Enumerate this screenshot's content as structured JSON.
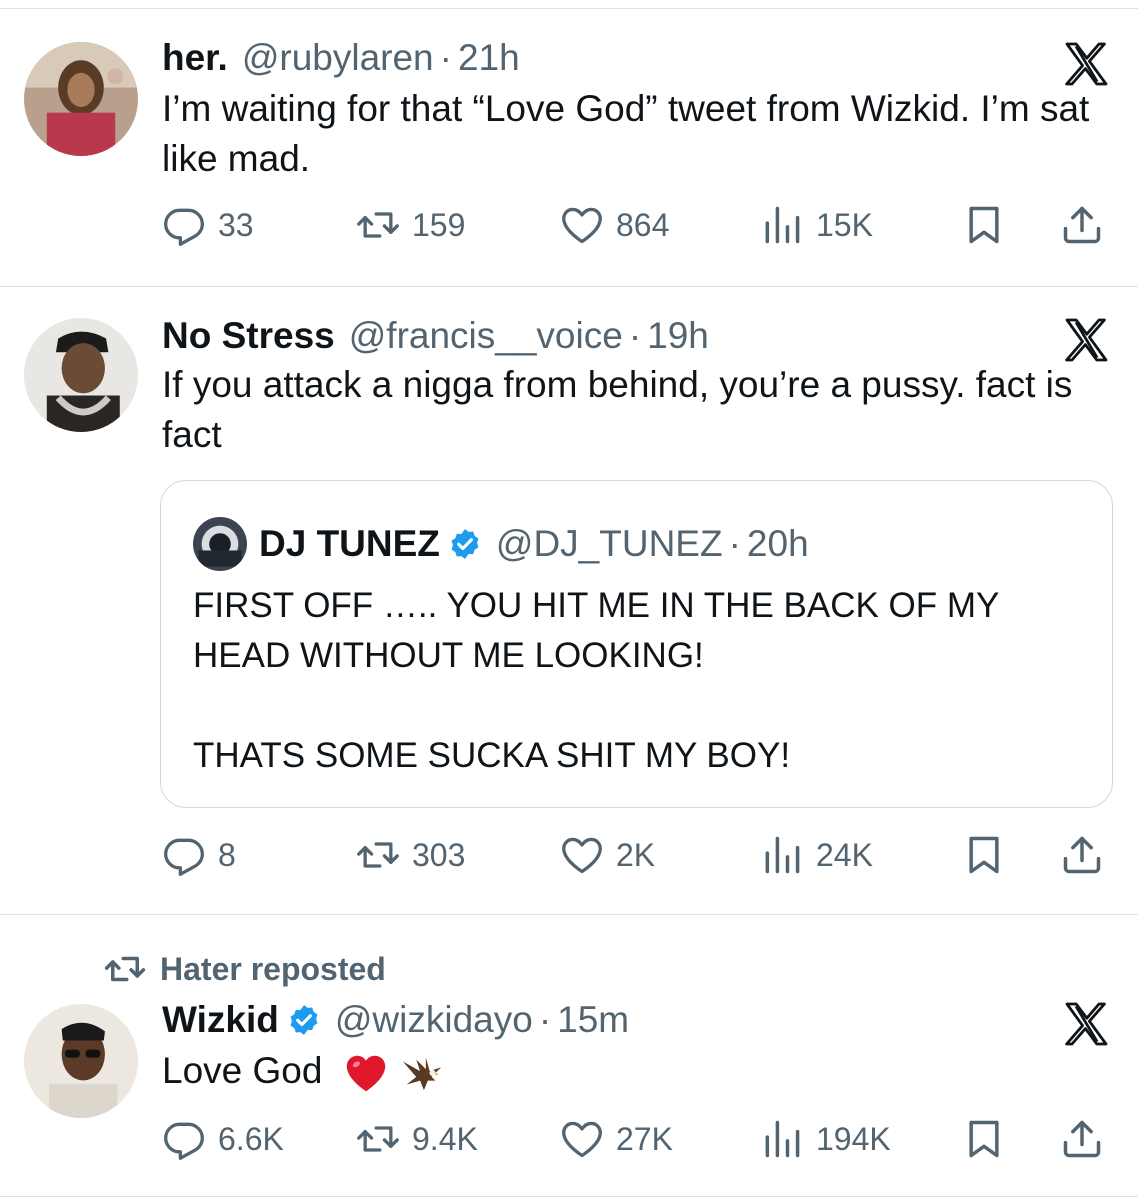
{
  "tweets": [
    {
      "name": "her.",
      "handle": "@rubylaren",
      "separator": "·",
      "time": "21h",
      "text": "I’m waiting for that “Love God” tweet from Wizkid. I’m sat like mad.",
      "replies": "33",
      "reposts": "159",
      "likes": "864",
      "views": "15K"
    },
    {
      "name": "No Stress",
      "handle": "@francis__voice",
      "separator": "·",
      "time": "19h",
      "text": "If you attack a nigga from behind, you’re a pussy. fact is fact",
      "quote": {
        "name": "DJ TUNEZ",
        "handle": "@DJ_TUNEZ",
        "separator": "·",
        "time": "20h",
        "line1": "FIRST OFF ….. YOU HIT ME IN THE BACK OF MY HEAD WITHOUT ME LOOKING!",
        "line2": "THATS SOME SUCKA SHIT MY BOY!"
      },
      "replies": "8",
      "reposts": "303",
      "likes": "2K",
      "views": "24K"
    },
    {
      "repost_label": "Hater reposted",
      "name": "Wizkid",
      "handle": "@wizkidayo",
      "separator": "·",
      "time": "15m",
      "text": "Love God",
      "emoji": [
        "red-heart",
        "eagle"
      ],
      "replies": "6.6K",
      "reposts": "9.4K",
      "likes": "27K",
      "views": "194K"
    }
  ],
  "colors": {
    "text": "#0f1419",
    "secondary": "#536471",
    "verified": "#1d9bf0",
    "divider": "#dfe3e6"
  },
  "icons": [
    "reply-icon",
    "repost-icon",
    "like-icon",
    "views-icon",
    "bookmark-icon",
    "share-icon",
    "x-logo-icon",
    "verified-badge-icon"
  ]
}
